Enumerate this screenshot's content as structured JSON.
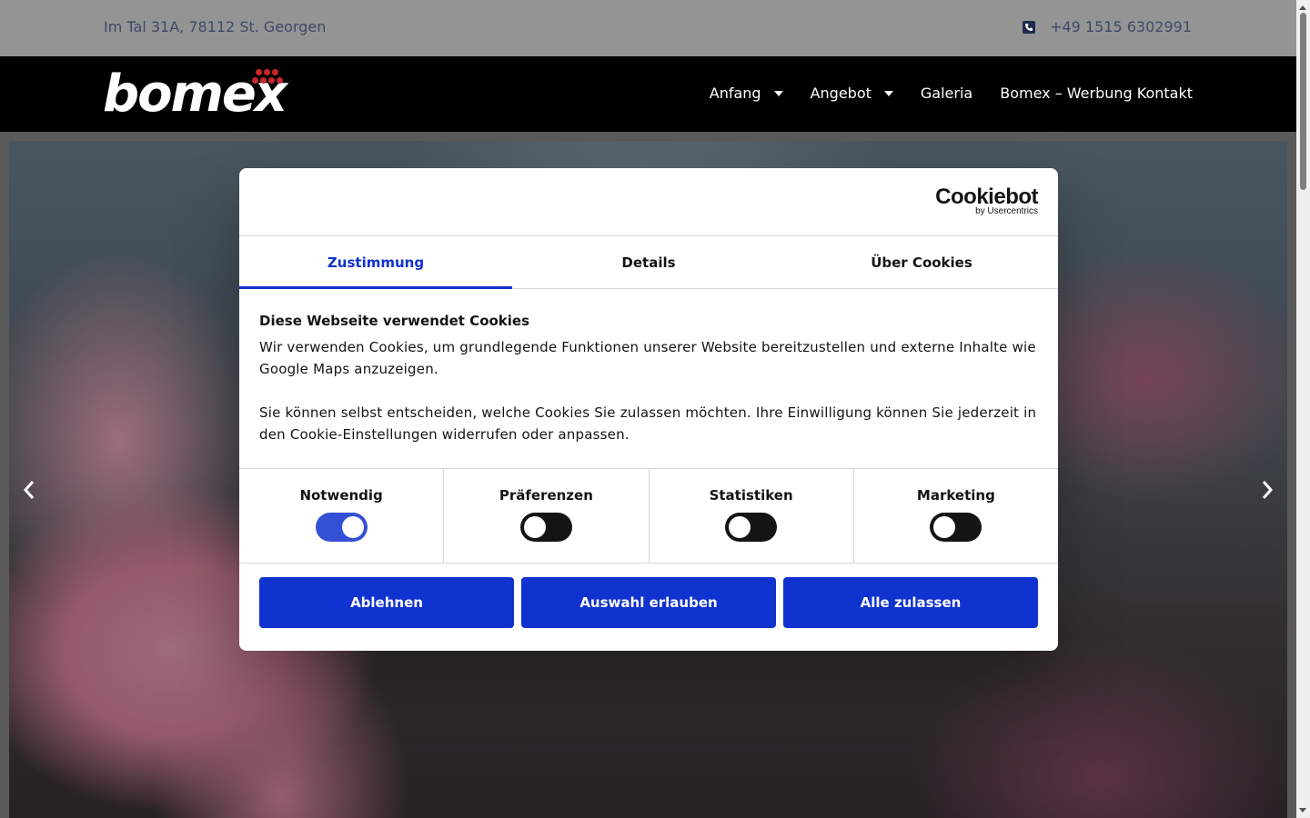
{
  "topbar": {
    "address": "Im Tal 31A, 78112 St. Georgen",
    "phone": "+49 1515 6302991",
    "phone_icon": "phone-icon"
  },
  "header": {
    "logo_text": "bomex",
    "logo_dot_color": "#c9262c",
    "nav": [
      {
        "label": "Anfang",
        "has_dropdown": true
      },
      {
        "label": "Angebot",
        "has_dropdown": true
      },
      {
        "label": "Galeria",
        "has_dropdown": false
      },
      {
        "label": "Bomex – Werbung Kontakt",
        "has_dropdown": false
      }
    ]
  },
  "hero": {
    "prev_icon": "chevron-left-icon",
    "next_icon": "chevron-right-icon"
  },
  "cookie_dialog": {
    "brand": "Cookiebot",
    "brand_sub": "by Usercentrics",
    "tabs": [
      {
        "label": "Zustimmung",
        "active": true
      },
      {
        "label": "Details",
        "active": false
      },
      {
        "label": "Über Cookies",
        "active": false
      }
    ],
    "title": "Diese Webseite verwendet Cookies",
    "paragraphs": [
      "Wir verwenden Cookies, um grundlegende Funktionen unserer Website bereitzustellen und externe Inhalte wie Google Maps anzuzeigen.",
      "Sie können selbst entscheiden, welche Cookies Sie zulassen möchten. Ihre Einwilligung können Sie jederzeit in den Cookie-Einstellungen widerrufen oder anpassen."
    ],
    "categories": [
      {
        "label": "Notwendig",
        "checked": true
      },
      {
        "label": "Präferenzen",
        "checked": false
      },
      {
        "label": "Statistiken",
        "checked": false
      },
      {
        "label": "Marketing",
        "checked": false
      }
    ],
    "buttons": {
      "decline": "Ablehnen",
      "allow_selection": "Auswahl erlauben",
      "allow_all": "Alle zulassen"
    },
    "accent_color": "#1032cf"
  }
}
